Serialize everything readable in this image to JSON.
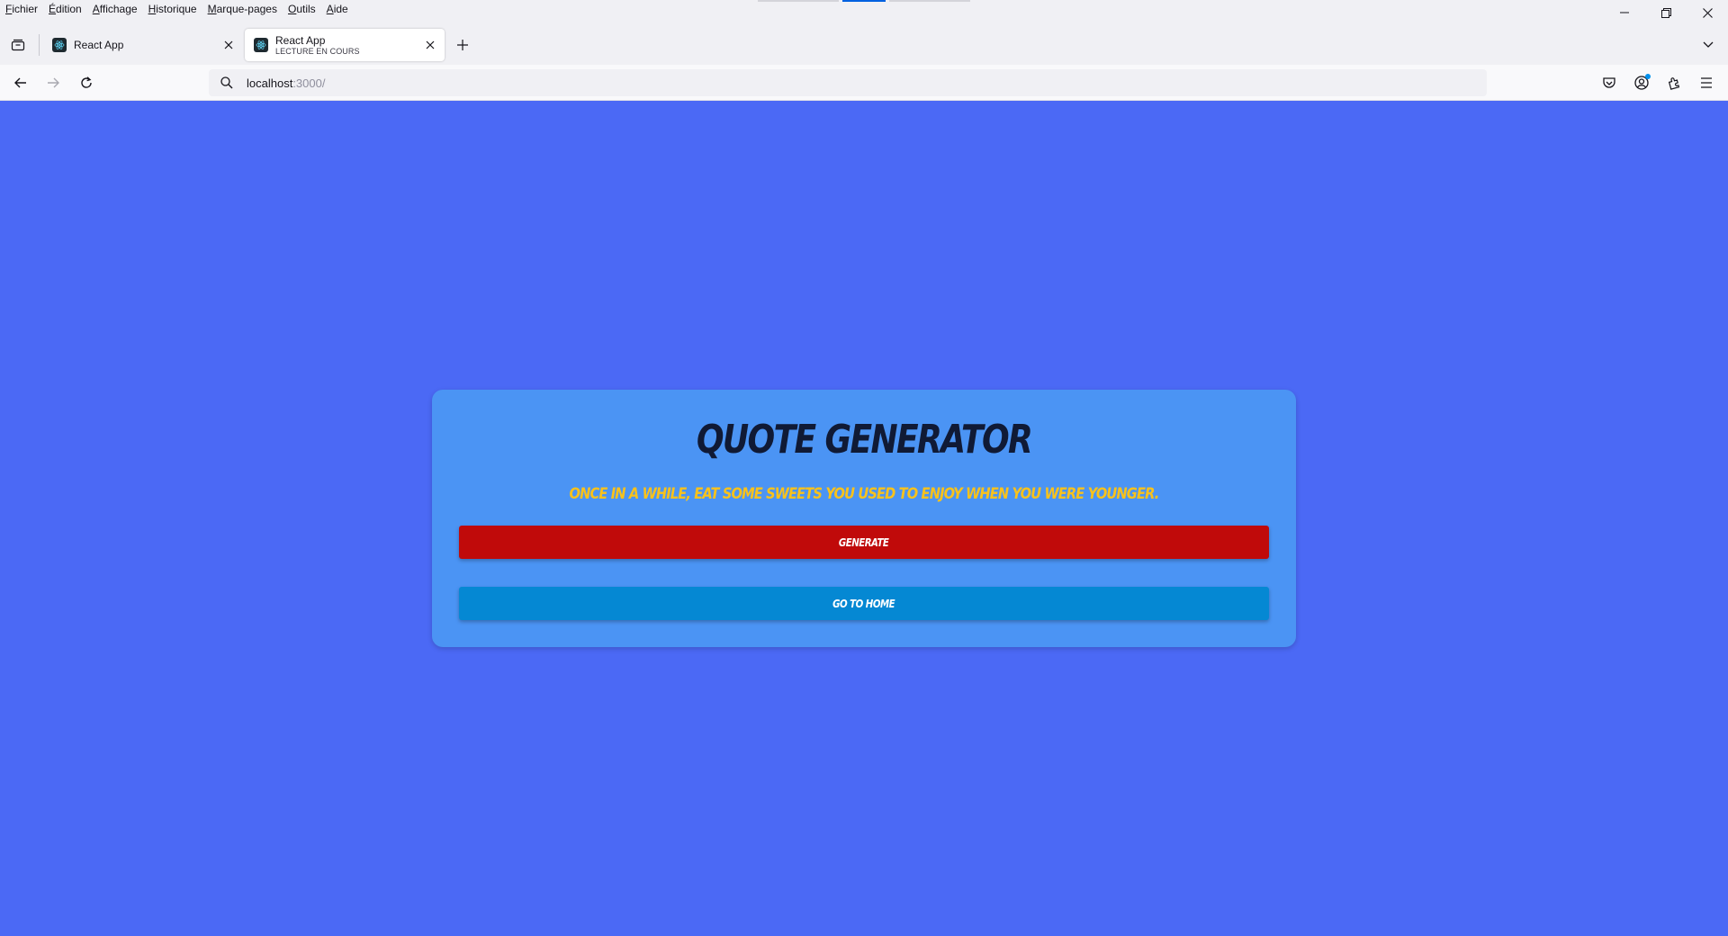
{
  "menubar": {
    "items": [
      {
        "accel": "F",
        "rest": "ichier"
      },
      {
        "accel": "É",
        "rest": "dition"
      },
      {
        "accel": "A",
        "rest": "ffichage"
      },
      {
        "accel": "H",
        "rest": "istorique"
      },
      {
        "accel": "M",
        "rest": "arque-pages"
      },
      {
        "accel": "O",
        "rest": "utils"
      },
      {
        "accel": "A",
        "rest": "ide"
      }
    ]
  },
  "tabs": [
    {
      "title": "React App",
      "subtitle": "",
      "active": false
    },
    {
      "title": "React App",
      "subtitle": "LECTURE EN COURS",
      "active": true
    }
  ],
  "address_bar": {
    "host": "localhost",
    "rest": ":3000/"
  },
  "page": {
    "title": "QUOTE GENERATOR",
    "quote": "ONCE IN A WHILE, EAT SOME SWEETS YOU USED TO ENJOY WHEN YOU WERE YOUNGER.",
    "generate_label": "GENERATE",
    "home_label": "GO TO HOME"
  },
  "colors": {
    "page_background": "#4b69f5",
    "card_background": "#4b94f4",
    "title": "#101a35",
    "quote": "#f9c21b",
    "generate_button": "#c00a0a",
    "home_button": "#0588d3"
  },
  "icons": [
    "tab-overview-icon",
    "react-favicon-icon",
    "close-icon",
    "plus-icon",
    "chevron-down-icon",
    "back-arrow-icon",
    "forward-arrow-icon",
    "reload-icon",
    "search-icon",
    "pocket-icon",
    "account-icon",
    "extensions-icon",
    "hamburger-menu-icon",
    "minimize-icon",
    "restore-icon",
    "window-close-icon"
  ]
}
